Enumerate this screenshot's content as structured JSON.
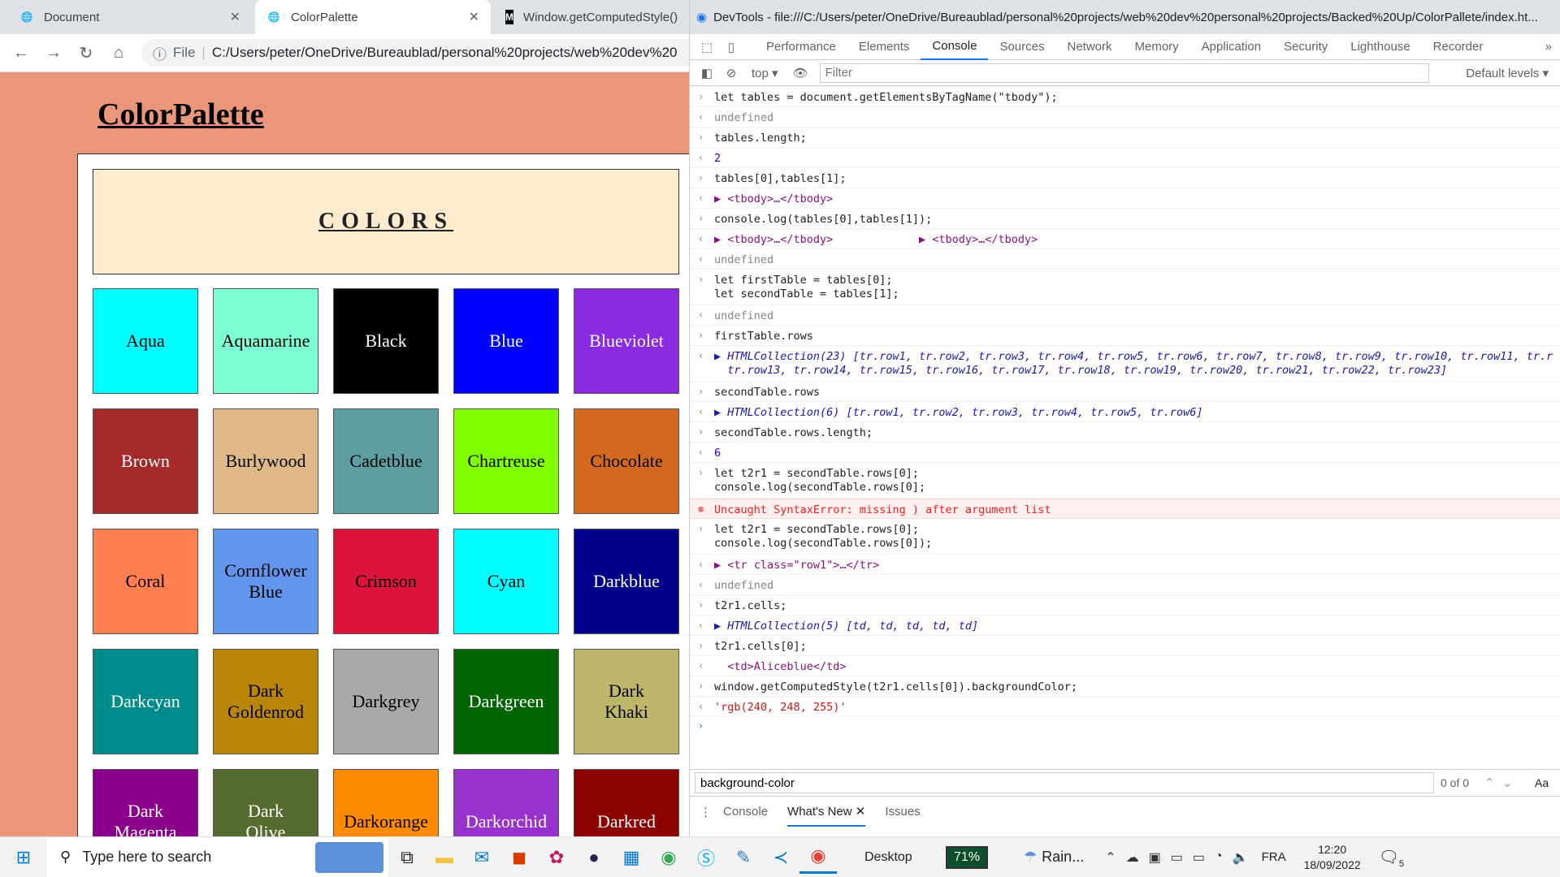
{
  "browser": {
    "tabs": [
      {
        "title": "Document"
      },
      {
        "title": "ColorPalette"
      },
      {
        "title": "Window.getComputedStyle()"
      }
    ],
    "omnibox_prefix": "File",
    "url": "C:/Users/peter/OneDrive/Bureaublad/personal%20projects/web%20dev%20"
  },
  "page": {
    "title": "ColorPalette",
    "header": "COLORS",
    "swatches": [
      {
        "label": "Aqua",
        "bg": "#00ffff",
        "fg": "#000000"
      },
      {
        "label": "Aquamarine",
        "bg": "#7fffd4",
        "fg": "#000000"
      },
      {
        "label": "Black",
        "bg": "#000000",
        "fg": "#ffffff"
      },
      {
        "label": "Blue",
        "bg": "#0000ff",
        "fg": "#ffffff"
      },
      {
        "label": "Blueviolet",
        "bg": "#8a2be2",
        "fg": "#ffffff"
      },
      {
        "label": "Brown",
        "bg": "#a52a2a",
        "fg": "#ffffff"
      },
      {
        "label": "Burlywood",
        "bg": "#deb887",
        "fg": "#000000"
      },
      {
        "label": "Cadetblue",
        "bg": "#5f9ea0",
        "fg": "#000000"
      },
      {
        "label": "Chartreuse",
        "bg": "#7fff00",
        "fg": "#000000"
      },
      {
        "label": "Chocolate",
        "bg": "#d2691e",
        "fg": "#000000"
      },
      {
        "label": "Coral",
        "bg": "#ff7f50",
        "fg": "#000000"
      },
      {
        "label": "Cornflower\nBlue",
        "bg": "#6495ed",
        "fg": "#000000"
      },
      {
        "label": "Crimson",
        "bg": "#dc143c",
        "fg": "#000000"
      },
      {
        "label": "Cyan",
        "bg": "#00ffff",
        "fg": "#000000"
      },
      {
        "label": "Darkblue",
        "bg": "#00008b",
        "fg": "#ffffff"
      },
      {
        "label": "Darkcyan",
        "bg": "#008b8b",
        "fg": "#ffffff"
      },
      {
        "label": "Dark\nGoldenrod",
        "bg": "#b8860b",
        "fg": "#000000"
      },
      {
        "label": "Darkgrey",
        "bg": "#a9a9a9",
        "fg": "#000000"
      },
      {
        "label": "Darkgreen",
        "bg": "#006400",
        "fg": "#ffffff"
      },
      {
        "label": "Dark\nKhaki",
        "bg": "#bdb76b",
        "fg": "#000000"
      },
      {
        "label": "Dark\nMagenta",
        "bg": "#8b008b",
        "fg": "#ffffff"
      },
      {
        "label": "Dark\nOlive",
        "bg": "#556b2f",
        "fg": "#ffffff"
      },
      {
        "label": "Darkorange",
        "bg": "#ff8c00",
        "fg": "#000000"
      },
      {
        "label": "Darkorchid",
        "bg": "#9932cc",
        "fg": "#ffffff"
      },
      {
        "label": "Darkred",
        "bg": "#8b0000",
        "fg": "#ffffff"
      }
    ]
  },
  "devtools": {
    "title": "DevTools - file:///C:/Users/peter/OneDrive/Bureaublad/personal%20projects/web%20dev%20personal%20projects/Backed%20Up/ColorPallete/index.ht...",
    "tabs": [
      "Performance",
      "Elements",
      "Console",
      "Sources",
      "Network",
      "Memory",
      "Application",
      "Security",
      "Lighthouse",
      "Recorder"
    ],
    "context": "top",
    "filter_placeholder": "Filter",
    "levels": "Default levels",
    "console_lines": [
      {
        "kind": "in",
        "text": "let tables = document.getElementsByTagName(\"tbody\");"
      },
      {
        "kind": "out",
        "text": "undefined"
      },
      {
        "kind": "in",
        "text": "tables.length;"
      },
      {
        "kind": "num",
        "text": "2"
      },
      {
        "kind": "in",
        "text": "tables[0],tables[1];"
      },
      {
        "kind": "obj",
        "text": "▶ <tbody>…</tbody>"
      },
      {
        "kind": "in",
        "text": "console.log(tables[0],tables[1]);"
      },
      {
        "kind": "obj",
        "text": "▶ <tbody>…</tbody>             ▶ <tbody>…</tbody>"
      },
      {
        "kind": "out",
        "text": "undefined"
      },
      {
        "kind": "in",
        "text": "let firstTable = tables[0];\nlet secondTable = tables[1];"
      },
      {
        "kind": "out",
        "text": "undefined"
      },
      {
        "kind": "in",
        "text": "firstTable.rows"
      },
      {
        "kind": "coll",
        "text": "▶ HTMLCollection(23) [tr.row1, tr.row2, tr.row3, tr.row4, tr.row5, tr.row6, tr.row7, tr.row8, tr.row9, tr.row10, tr.row11, tr.r\n  tr.row13, tr.row14, tr.row15, tr.row16, tr.row17, tr.row18, tr.row19, tr.row20, tr.row21, tr.row22, tr.row23]"
      },
      {
        "kind": "in",
        "text": "secondTable.rows"
      },
      {
        "kind": "coll",
        "text": "▶ HTMLCollection(6) [tr.row1, tr.row2, tr.row3, tr.row4, tr.row5, tr.row6]"
      },
      {
        "kind": "in",
        "text": "secondTable.rows.length;"
      },
      {
        "kind": "num",
        "text": "6"
      },
      {
        "kind": "in",
        "text": "let t2r1 = secondTable.rows[0];\nconsole.log(secondTable.rows[0];"
      },
      {
        "kind": "err",
        "text": "Uncaught SyntaxError: missing ) after argument list"
      },
      {
        "kind": "in",
        "text": "let t2r1 = secondTable.rows[0];\nconsole.log(secondTable.rows[0]);"
      },
      {
        "kind": "obj",
        "text": "▶ <tr class=\"row1\">…</tr>"
      },
      {
        "kind": "out",
        "text": "undefined"
      },
      {
        "kind": "in",
        "text": "t2r1.cells;"
      },
      {
        "kind": "coll",
        "text": "▶ HTMLCollection(5) [td, td, td, td, td]"
      },
      {
        "kind": "in",
        "text": "t2r1.cells[0];"
      },
      {
        "kind": "obj",
        "text": "  <td>Aliceblue</td>"
      },
      {
        "kind": "in",
        "text": "window.getComputedStyle(t2r1.cells[0]).backgroundColor;"
      },
      {
        "kind": "str",
        "text": "'rgb(240, 248, 255)'"
      }
    ],
    "search_value": "background-color",
    "search_count": "0 of 0",
    "search_case": "Aa",
    "drawer_tabs": [
      "Console",
      "What's New",
      "Issues"
    ]
  },
  "taskbar": {
    "search_placeholder": "Type here to search",
    "desktop": "Desktop",
    "battery": "71%",
    "weather": "Rain...",
    "lang": "FRA",
    "time": "12:20",
    "date": "18/09/2022",
    "notif_count": "5"
  }
}
